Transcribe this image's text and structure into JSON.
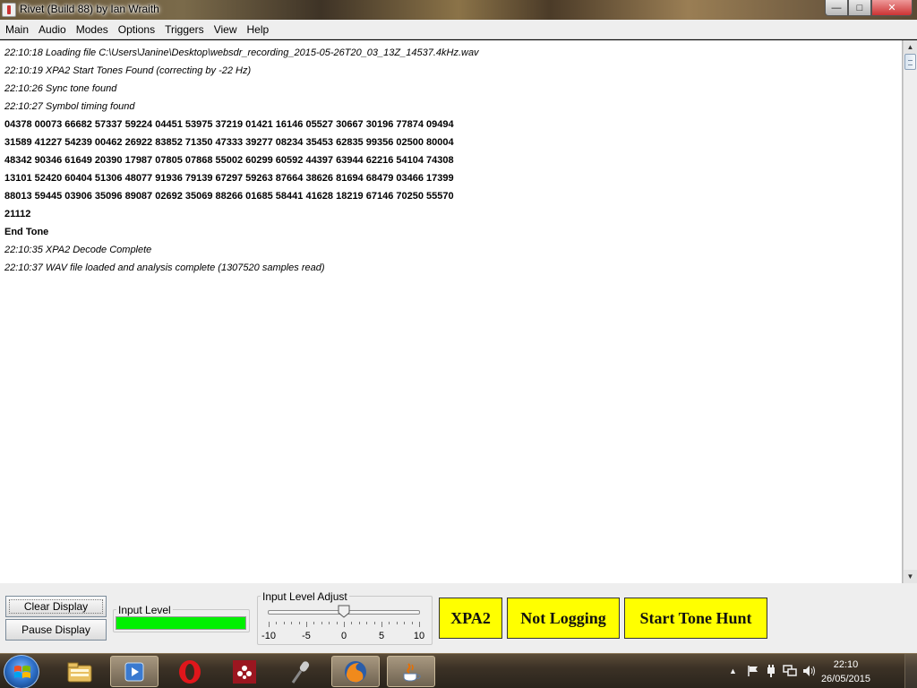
{
  "window": {
    "title": "Rivet (Build 88) by Ian Wraith",
    "min_glyph": "—",
    "max_glyph": "□",
    "close_glyph": "✕"
  },
  "menu": [
    "Main",
    "Audio",
    "Modes",
    "Options",
    "Triggers",
    "View",
    "Help"
  ],
  "log": [
    {
      "text": "22:10:18 Loading file C:\\Users\\Janine\\Desktop\\websdr_recording_2015-05-26T20_03_13Z_14537.4kHz.wav",
      "style": "info"
    },
    {
      "text": "22:10:19 XPA2 Start Tones Found (correcting by -22 Hz)",
      "style": "info"
    },
    {
      "text": "22:10:26 Sync tone found",
      "style": "info"
    },
    {
      "text": "22:10:27 Symbol timing found",
      "style": "info"
    },
    {
      "text": "04378 00073 66682 57337 59224 04451 53975 37219 01421 16146 05527 30667 30196 77874 09494",
      "style": "code"
    },
    {
      "text": "31589 41227 54239 00462 26922 83852 71350 47333 39277 08234 35453 62835 99356 02500 80004",
      "style": "code"
    },
    {
      "text": "48342 90346 61649 20390 17987 07805 07868 55002 60299 60592 44397 63944 62216 54104 74308",
      "style": "code"
    },
    {
      "text": "13101 52420 60404 51306 48077 91936 79139 67297 59263 87664 38626 81694 68479 03466 17399",
      "style": "code"
    },
    {
      "text": "88013 59445 03906 35096 89087 02692 35069 88266 01685 58441 41628 18219 67146 70250 55570",
      "style": "code"
    },
    {
      "text": "21112",
      "style": "code"
    },
    {
      "text": "End Tone",
      "style": "code"
    },
    {
      "text": "22:10:35 XPA2 Decode Complete",
      "style": "info"
    },
    {
      "text": "22:10:37 WAV file loaded and analysis complete (1307520 samples read)",
      "style": "info"
    }
  ],
  "scrollbar": {
    "up_glyph": "▲",
    "down_glyph": "▼"
  },
  "controls": {
    "clear_label": "Clear Display",
    "pause_label": "Pause Display",
    "input_level_label": "Input Level",
    "input_level_fraction": 1.0,
    "level_color": "#00f000",
    "adjust_label": "Input Level Adjust",
    "slider": {
      "min": -10,
      "max": 10,
      "value": 0,
      "tick_labels": [
        "-10",
        "-5",
        "0",
        "5",
        "10"
      ]
    },
    "mode_label": "XPA2",
    "logging_label": "Not Logging",
    "tone_hunt_label": "Start Tone Hunt",
    "button_color": "#ffff00"
  },
  "taskbar": {
    "items": [
      "windows-explorer-icon",
      "media-player-icon",
      "opera-icon",
      "mendeley-icon",
      "microphone-icon",
      "firefox-icon",
      "java-icon"
    ],
    "active_item": "java-icon",
    "tray_expand_glyph": "▲",
    "clock_time": "22:10",
    "clock_date": "26/05/2015"
  }
}
